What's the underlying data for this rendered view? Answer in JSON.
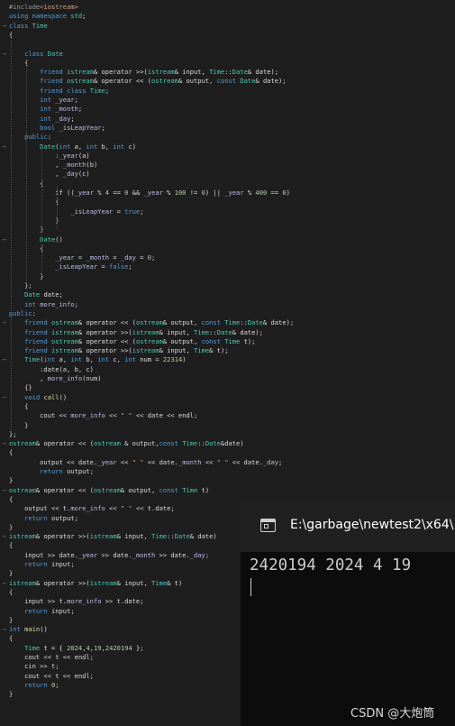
{
  "editor": {
    "lines": [
      "#include<iostream>",
      "using namespace std;",
      "class Time",
      "{",
      "",
      "    class Date",
      "    {",
      "        friend istream& operator >>(istream& input, Time::Date& date);",
      "        friend ostream& operator << (ostream& output, const Date& date);",
      "        friend class Time;",
      "        int _year;",
      "        int _month;",
      "        int _day;",
      "        bool _isLeapYear;",
      "    public:",
      "        Date(int a, int b, int c)",
      "            :_year(a)",
      "            , _month(b)",
      "            , _day(c)",
      "        {",
      "            if ((_year % 4 == 0 && _year % 100 != 0) || _year % 400 == 0)",
      "            {",
      "                _isLeapYear = true;",
      "            }",
      "        }",
      "        Date()",
      "        {",
      "            _year = _month = _day = 0;",
      "            _isLeapYear = false;",
      "        }",
      "    };",
      "    Date date;",
      "    int more_info;",
      "public:",
      "    friend ostream& operator << (ostream& output, const Time::Date& date);",
      "    friend istream& operator >>(istream& input, Time::Date& date);",
      "    friend ostream& operator << (ostream& output, const Time t);",
      "    friend istream& operator >>(istream& input, Time& t);",
      "    Time(int a, int b, int c, int num = 22314)",
      "        :date(a, b, c)",
      "        , more_info(num)",
      "    {}",
      "    void call()",
      "    {",
      "        cout << more_info << \" \" << date << endl;",
      "    }",
      "};",
      "ostream& operator << (ostream & output,const Time::Date&date)",
      "{",
      "        output << date._year << \" \" << date._month << \" \" << date._day;",
      "        return output;",
      "}",
      "ostream& operator << (ostream& output, const Time t)",
      "{",
      "    output << t.more_info << \" \" << t.date;",
      "    return output;",
      "}",
      "istream& operator >>(istream& input, Time::Date& date)",
      "{",
      "    input >> date._year >> date._month >> date._day;",
      "    return input;",
      "}",
      "istream& operator >>(istream& input, Time& t)",
      "{",
      "    input >> t.more_info >> t.date;",
      "    return input;",
      "}",
      "int main()",
      "{",
      "    Time t = { 2024,4,19,2420194 };",
      "    cout << t << endl;",
      "    cin >> t;",
      "    cout << t << endl;",
      "    return 0;",
      "}"
    ]
  },
  "console": {
    "title": "E:\\garbage\\newtest2\\x64\\",
    "output": "2420194 2024 4 19"
  },
  "watermark": "CSDN @大炮筒",
  "colors": {
    "editor_bg": "#1e1e1e",
    "keyword": "#569cd6",
    "type": "#4ec9b0",
    "function": "#dcdcaa",
    "text": "#dcdcdc",
    "console_bg": "#0c0c0c",
    "console_titlebar": "#202020"
  }
}
